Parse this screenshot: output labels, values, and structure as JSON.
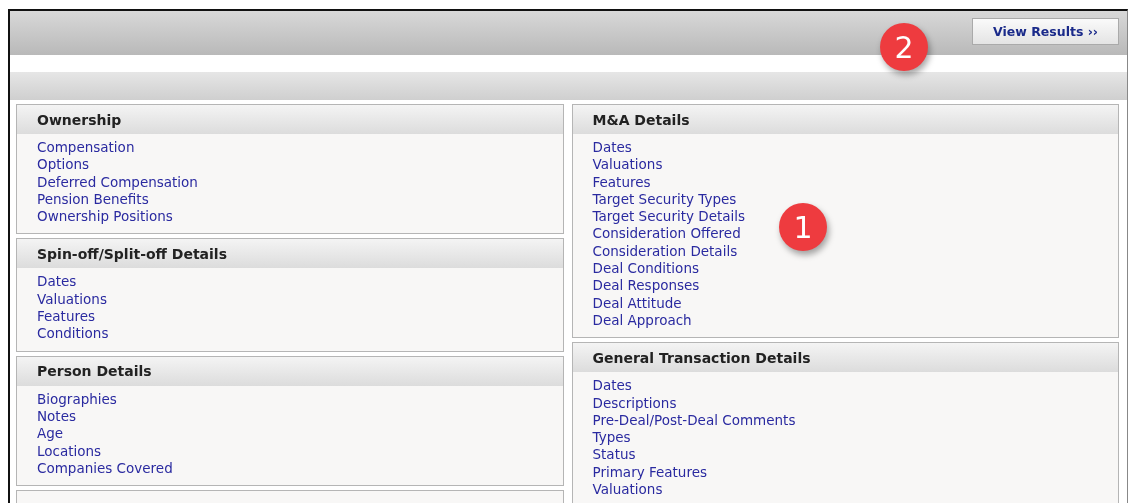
{
  "toolbar": {
    "button": "View Results ››"
  },
  "columns": [
    [
      {
        "title": "Ownership",
        "links": [
          "Compensation",
          "Options",
          "Deferred Compensation",
          "Pension Benefits",
          "Ownership Positions"
        ]
      },
      {
        "title": "Spin-off/Split-off Details",
        "links": [
          "Dates",
          "Valuations",
          "Features",
          "Conditions"
        ]
      },
      {
        "title": "Person Details",
        "links": [
          "Biographies",
          "Notes",
          "Age",
          "Locations",
          "Companies Covered"
        ]
      }
    ],
    [
      {
        "title": "M&A Details",
        "links": [
          "Dates",
          "Valuations",
          "Features",
          "Target Security Types",
          "Target Security Details",
          "Consideration Offered",
          "Consideration Details",
          "Deal Conditions",
          "Deal Responses",
          "Deal Attitude",
          "Deal Approach"
        ]
      },
      {
        "title": "General Transaction Details",
        "links": [
          "Dates",
          "Descriptions",
          "Pre-Deal/Post-Deal Comments",
          "Types",
          "Status",
          "Primary Features",
          "Valuations"
        ]
      }
    ]
  ],
  "callouts": [
    "1",
    "2"
  ]
}
